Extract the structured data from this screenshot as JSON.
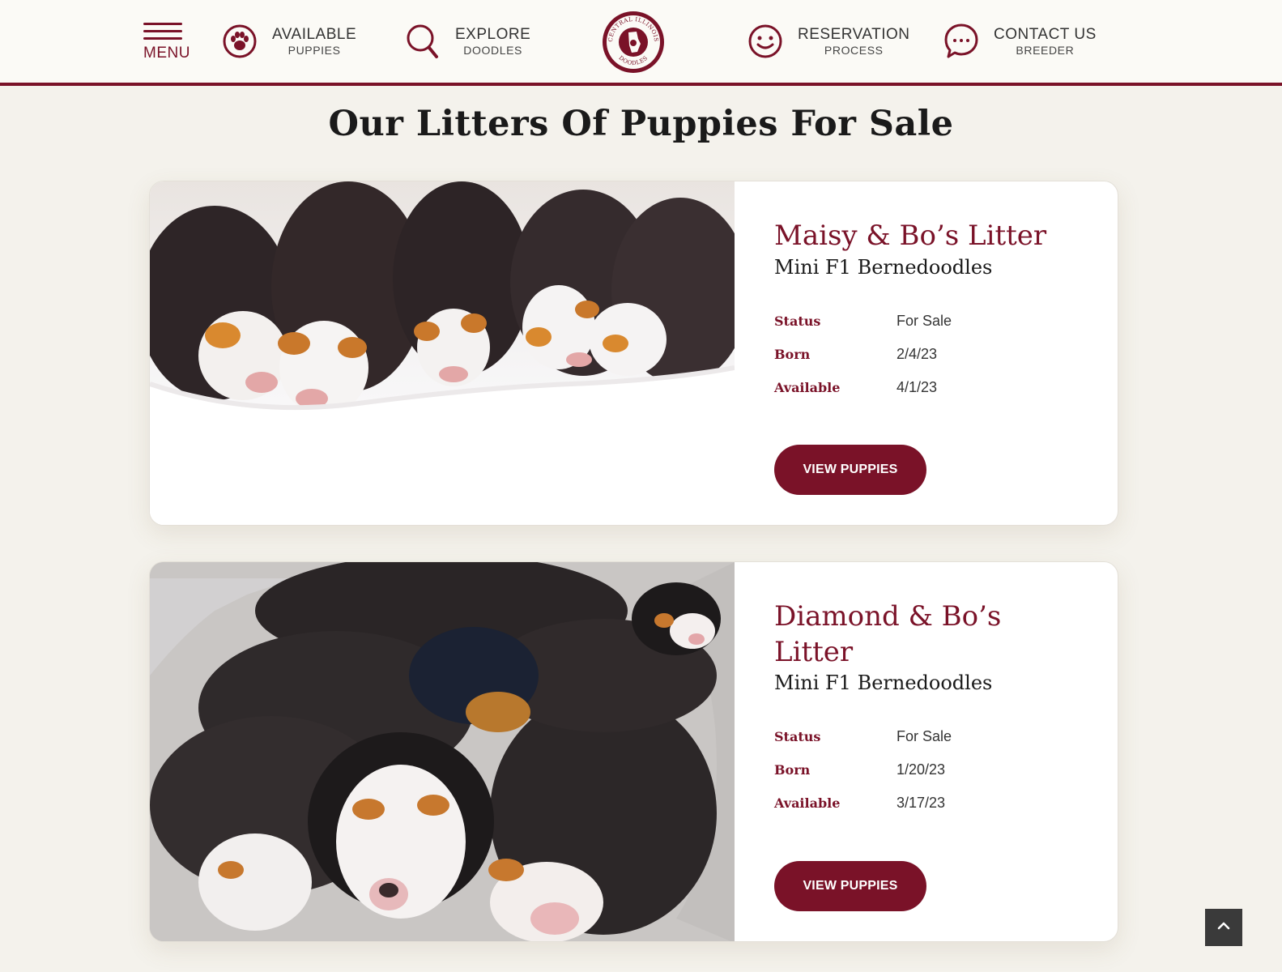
{
  "header": {
    "menu_label": "MENU",
    "nav": [
      {
        "line1": "AVAILABLE",
        "line2": "PUPPIES",
        "icon": "paw-icon"
      },
      {
        "line1": "EXPLORE",
        "line2": "DOODLES",
        "icon": "search-icon"
      },
      {
        "line1": "RESERVATION",
        "line2": "PROCESS",
        "icon": "smiley-icon"
      },
      {
        "line1": "CONTACT US",
        "line2": "BREEDER",
        "icon": "chat-icon"
      }
    ],
    "logo_text_top": "CENTRAL ILLINOIS",
    "logo_text_bottom": "DOODLES"
  },
  "page_title": "Our Litters Of Puppies For Sale",
  "litters": [
    {
      "name": "Maisy & Bo’s Litter",
      "type": "Mini F1 Bernedoodles",
      "status_label": "Status",
      "status": "For Sale",
      "born_label": "Born",
      "born": "2/4/23",
      "available_label": "Available",
      "available": "4/1/23",
      "button": "VIEW PUPPIES"
    },
    {
      "name": "Diamond & Bo’s Litter",
      "type": "Mini F1 Bernedoodles",
      "status_label": "Status",
      "status": "For Sale",
      "born_label": "Born",
      "born": "1/20/23",
      "available_label": "Available",
      "available": "3/17/23",
      "button": "VIEW PUPPIES"
    }
  ],
  "colors": {
    "brand": "#7a1228",
    "background": "#f4f2ec",
    "header_bg": "#fbfaf6"
  }
}
